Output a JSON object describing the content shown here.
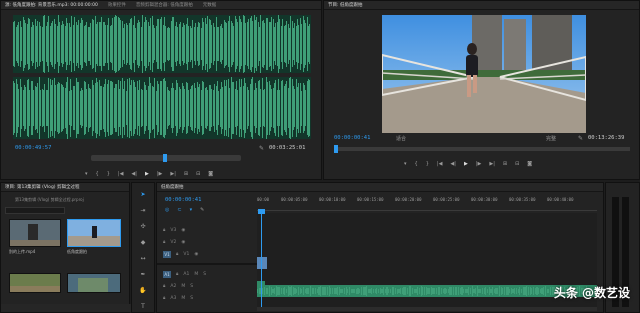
{
  "source_monitor": {
    "tabs": [
      "源: 低角度跟拍: 背景音乐.mp3: 00:00:00:00",
      "效果控件",
      "音频剪辑混合器: 低角度跟拍",
      "元数据"
    ],
    "current_time": "00:00:49:57",
    "duration": "00:03:25:01"
  },
  "program_monitor": {
    "tab": "节目: 低角度跟拍",
    "current_time": "00:00:00:41",
    "fit_label": "适合",
    "quality_label": "完整",
    "duration": "00:13:26:39"
  },
  "project_panel": {
    "tab": "项目: 第13集剪辑 (Vlog) 剪辑全过程",
    "path": "第13集剪辑 (Vlog) 剪辑全过程.prproj",
    "items": [
      {
        "label": "别的上传.mp4",
        "duration": "",
        "color": "#3b4a55"
      },
      {
        "label": "低角度跟拍",
        "duration": "",
        "color": "#5d7fa6"
      },
      {
        "label": "",
        "duration": "",
        "color": "#5d6b4c"
      },
      {
        "label": "",
        "duration": "",
        "color": "#4c6b7c"
      }
    ]
  },
  "timeline": {
    "tab": "低角度跟拍",
    "current_time": "00:00:00:41",
    "ruler": [
      "00:00",
      "00:00:05:00",
      "00:00:10:00",
      "00:00:15:00",
      "00:00:20:00",
      "00:00:25:00",
      "00:00:30:00",
      "00:00:35:00",
      "00:00:40:00",
      "00:00:45:00"
    ],
    "video_tracks": [
      "V3",
      "V2",
      "V1"
    ],
    "audio_tracks": [
      "A1",
      "A2",
      "A3"
    ],
    "source_target": "V1",
    "audio_target": "A1"
  },
  "watermark": "头条 @数艺设",
  "colors": {
    "timecode_blue": "#2e9bf0",
    "waveform_green": "#3f9f78",
    "audio_clip_green": "#2f8a66",
    "video_clip_blue": "#5a87b8"
  }
}
